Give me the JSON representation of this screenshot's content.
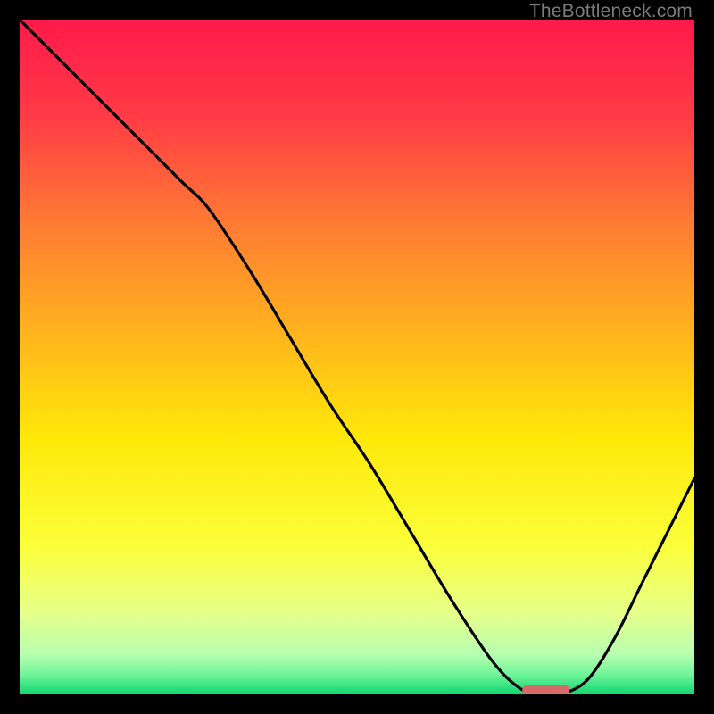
{
  "watermark": "TheBottleneck.com",
  "chart_data": {
    "type": "line",
    "title": "",
    "xlabel": "",
    "ylabel": "",
    "x_range": [
      0,
      100
    ],
    "y_range": [
      0,
      100
    ],
    "series": [
      {
        "name": "bottleneck-curve",
        "x": [
          0,
          6,
          12,
          18,
          24,
          28,
          34,
          40,
          46,
          52,
          58,
          64,
          70,
          74,
          77,
          80,
          84,
          88,
          92,
          96,
          100
        ],
        "y": [
          100,
          94,
          88,
          82,
          76,
          72,
          63,
          53,
          43,
          34,
          24,
          14,
          5,
          1,
          0,
          0,
          2,
          8,
          16,
          24,
          32
        ]
      }
    ],
    "marker": {
      "name": "optimal-range",
      "x_center": 78,
      "y": 0.7,
      "width": 7,
      "color": "#d66a6a"
    },
    "gradient_stops": [
      {
        "pct": 0,
        "color": "#ff1a4b"
      },
      {
        "pct": 14,
        "color": "#ff3a46"
      },
      {
        "pct": 30,
        "color": "#ff7a34"
      },
      {
        "pct": 46,
        "color": "#ffb21e"
      },
      {
        "pct": 62,
        "color": "#ffe80a"
      },
      {
        "pct": 78,
        "color": "#fbff3a"
      },
      {
        "pct": 88,
        "color": "#e6ff8a"
      },
      {
        "pct": 94,
        "color": "#b8ffb0"
      },
      {
        "pct": 97,
        "color": "#72f59a"
      },
      {
        "pct": 99,
        "color": "#2fe07e"
      },
      {
        "pct": 100,
        "color": "#15d86f"
      }
    ]
  }
}
